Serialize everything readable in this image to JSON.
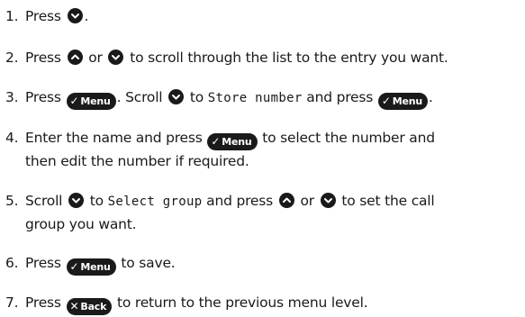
{
  "keys": {
    "menu_label": "Menu",
    "menu_glyph": "✓",
    "back_label": "Back",
    "back_glyph": "✕"
  },
  "steps": [
    {
      "num": "1.",
      "a": "Press",
      "b": "."
    },
    {
      "num": "2.",
      "a": "Press",
      "b": "or",
      "c": "to scroll through the list to the entry you want."
    },
    {
      "num": "3.",
      "a": "Press",
      "b": ". Scroll",
      "c": "to",
      "screen": "Store number",
      "d": "and press",
      "e": "."
    },
    {
      "num": "4.",
      "a": "Enter the name and press",
      "b": "to select the number and",
      "c": "then edit the number if required."
    },
    {
      "num": "5.",
      "a": "Scroll",
      "b": "to",
      "screen": "Select group",
      "c": "and press",
      "d": "or",
      "e": "to set the call",
      "f": "group you want."
    },
    {
      "num": "6.",
      "a": "Press",
      "b": "to save."
    },
    {
      "num": "7.",
      "a": "Press",
      "b": "to return to the previous menu level."
    }
  ]
}
